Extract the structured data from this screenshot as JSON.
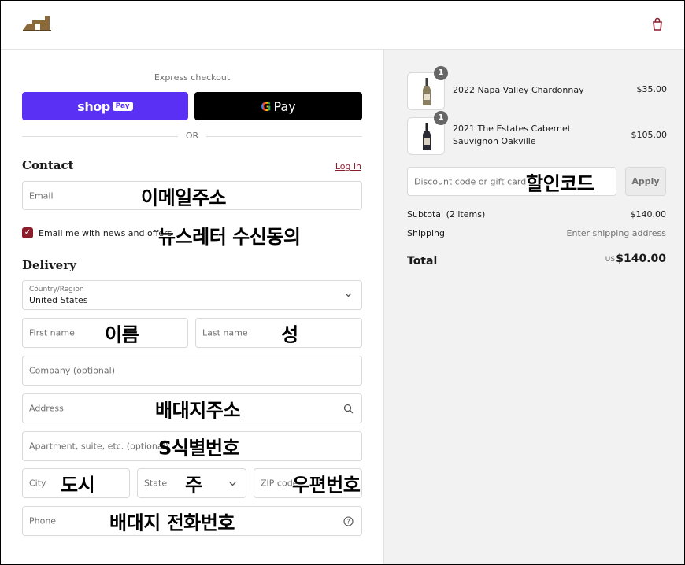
{
  "header": {
    "logo": "winery-logo",
    "cart_icon": "shopping-bag-icon"
  },
  "express": {
    "label": "Express checkout",
    "shop_pay": {
      "shop": "shop",
      "pay": "Pay"
    },
    "gpay": {
      "g": "G",
      "pay": "Pay"
    },
    "or": "OR"
  },
  "contact": {
    "title": "Contact",
    "login": "Log in",
    "email": {
      "placeholder": "Email",
      "annotation": "이메일주소"
    },
    "newsletter": {
      "label": "Email me with news and offers",
      "checked": true,
      "annotation": "뉴스레터 수신동의"
    }
  },
  "delivery": {
    "title": "Delivery",
    "country": {
      "label": "Country/Region",
      "value": "United States"
    },
    "first_name": {
      "placeholder": "First name",
      "annotation": "이름"
    },
    "last_name": {
      "placeholder": "Last name",
      "annotation": "성"
    },
    "company": {
      "placeholder": "Company (optional)"
    },
    "address": {
      "placeholder": "Address",
      "annotation": "배대지주소"
    },
    "apartment": {
      "placeholder": "Apartment, suite, etc. (optional)",
      "annotation": "S식별번호"
    },
    "city": {
      "placeholder": "City",
      "annotation": "도시"
    },
    "state": {
      "placeholder": "State",
      "annotation": "주"
    },
    "zip": {
      "placeholder": "ZIP code",
      "annotation": "우편번호"
    },
    "phone": {
      "placeholder": "Phone",
      "annotation": "배대지 전화번호"
    }
  },
  "order": {
    "items": [
      {
        "qty": "1",
        "name": "2022 Napa Valley Chardonnay",
        "price": "$35.00",
        "bottle_color": "#8a8060"
      },
      {
        "qty": "1",
        "name": "2021 The Estates Cabernet Sauvignon Oakville",
        "price": "$105.00",
        "bottle_color": "#2a2a35"
      }
    ],
    "discount": {
      "placeholder": "Discount code or gift card",
      "annotation": "할인코드",
      "apply": "Apply"
    },
    "subtotal": {
      "label": "Subtotal (2 items)",
      "value": "$140.00"
    },
    "shipping": {
      "label": "Shipping",
      "value": "Enter shipping address"
    },
    "total": {
      "label": "Total",
      "currency": "USD",
      "value": "$140.00"
    }
  },
  "colors": {
    "accent": "#8b1c2c",
    "shop_pay": "#5a31f4",
    "gpay": "#000000",
    "summary_bg": "#f2f2f2"
  }
}
